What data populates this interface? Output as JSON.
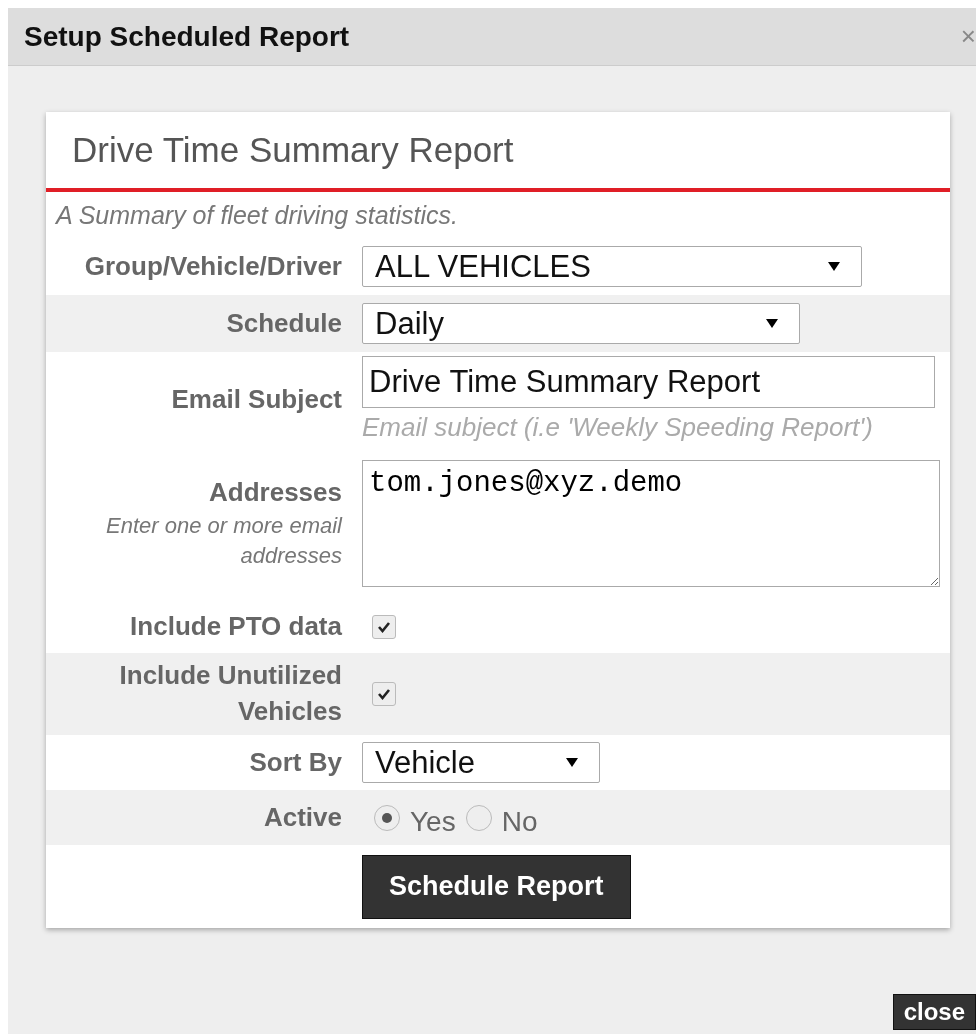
{
  "window": {
    "title": "Setup Scheduled Report",
    "close_glyph": "×"
  },
  "report": {
    "title": "Drive Time Summary Report",
    "description": "A Summary of fleet driving statistics."
  },
  "rows": [
    {
      "kind": "select",
      "label": "Group/Vehicle/Driver",
      "value": "ALL VEHICLES",
      "shaded": false
    },
    {
      "kind": "select",
      "label": "Schedule",
      "value": "Daily",
      "shaded": true
    },
    {
      "kind": "text",
      "label": "Email Subject",
      "value": "Drive Time Summary Report",
      "hint": "Email subject (i.e 'Weekly Speeding Report')",
      "shaded": false
    },
    {
      "kind": "textarea",
      "label": "Addresses",
      "sublabel": "Enter one or more email addresses",
      "value": "tom.jones@xyz.demo",
      "shaded": false
    },
    {
      "kind": "checkbox",
      "label": "Include PTO data",
      "checked": true,
      "shaded": false
    },
    {
      "kind": "checkbox",
      "label": "Include Unutilized Vehicles",
      "checked": true,
      "shaded": true
    },
    {
      "kind": "select",
      "label": "Sort By",
      "value": "Vehicle",
      "shaded": false
    },
    {
      "kind": "radio",
      "label": "Active",
      "shaded": true,
      "options": [
        {
          "label": "Yes",
          "selected": true
        },
        {
          "label": "No",
          "selected": false
        }
      ]
    }
  ],
  "submit": "Schedule Report",
  "close_button": "close"
}
